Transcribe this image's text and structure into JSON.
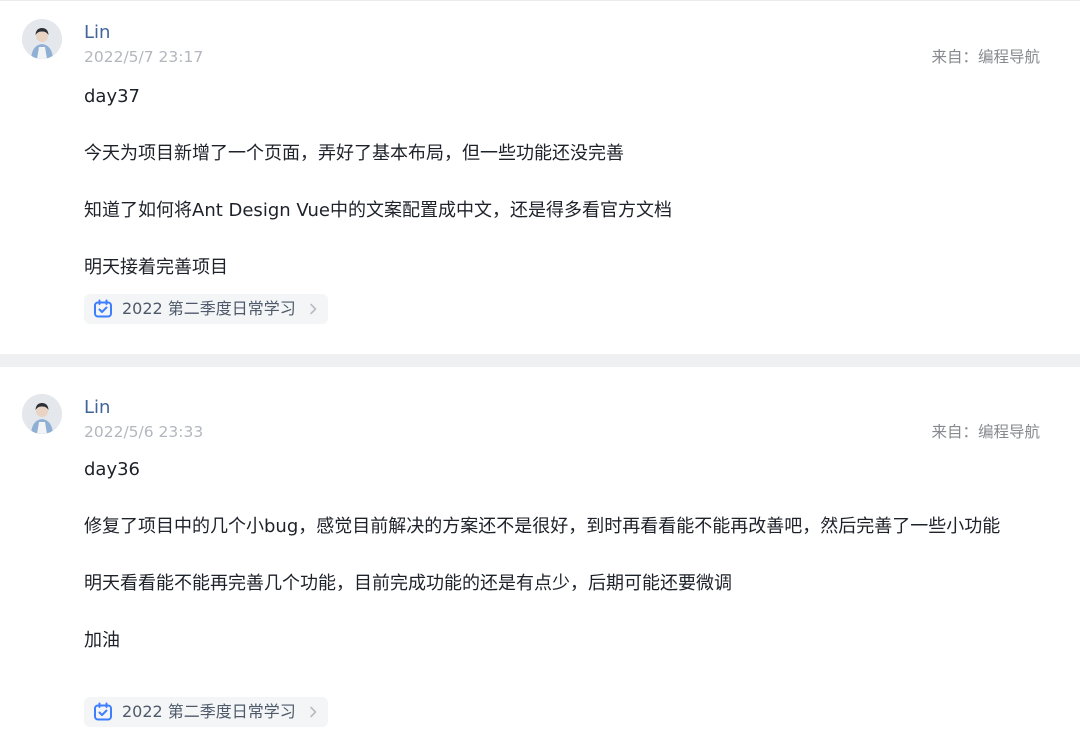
{
  "posts": [
    {
      "author": "Lin",
      "time": "2022/5/7 23:17",
      "source": "来自：编程导航",
      "paragraphs": [
        "day37",
        "今天为项目新增了一个页面，弄好了基本布局，但一些功能还没完善",
        "知道了如何将Ant Design Vue中的文案配置成中文，还是得多看官方文档",
        "明天接着完善项目"
      ],
      "tag": "2022 第二季度日常学习"
    },
    {
      "author": "Lin",
      "time": "2022/5/6 23:33",
      "source": "来自：编程导航",
      "paragraphs": [
        "day36",
        "修复了项目中的几个小bug，感觉目前解决的方案还不是很好，到时再看看能不能再改善吧，然后完善了一些小功能",
        "明天看看能不能再完善几个功能，目前完成功能的还是有点少，后期可能还要微调",
        "加油"
      ],
      "tag": "2022 第二季度日常学习"
    }
  ],
  "colors": {
    "author": "#406599",
    "timestamp": "#b3b7bd",
    "source": "#86898e",
    "tag_icon": "#3d7eff",
    "separator": "#eff0f2"
  },
  "icons": {
    "tag": "calendar-check-icon",
    "tag_arrow": "chevron-right-icon"
  }
}
